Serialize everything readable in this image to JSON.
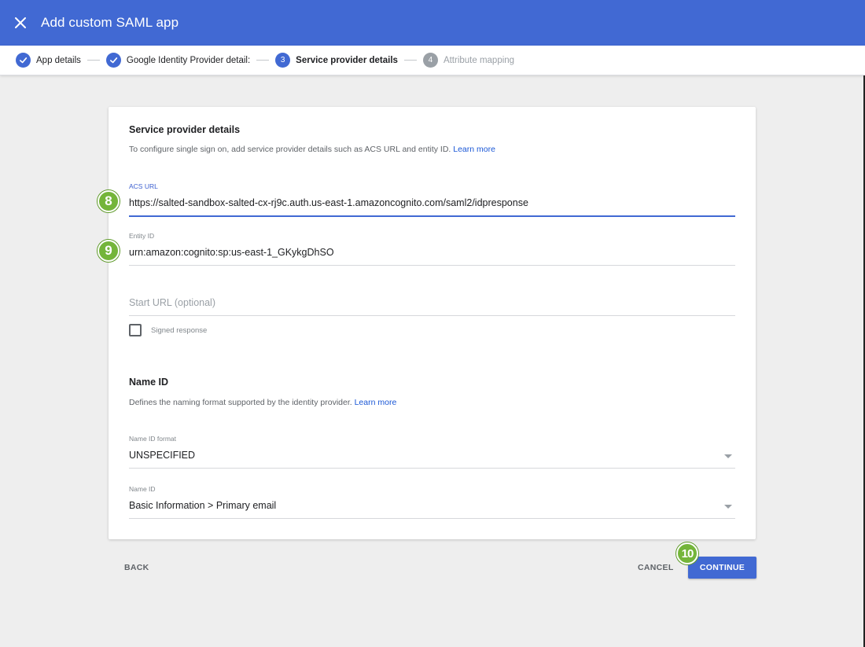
{
  "appbar": {
    "title": "Add custom SAML app"
  },
  "stepper": {
    "steps": [
      {
        "number": "",
        "label": "App details",
        "state": "done"
      },
      {
        "number": "",
        "label": "Google Identity Provider detail:",
        "state": "done"
      },
      {
        "number": "3",
        "label": "Service provider details",
        "state": "active"
      },
      {
        "number": "4",
        "label": "Attribute mapping",
        "state": "pending"
      }
    ]
  },
  "service_provider": {
    "title": "Service provider details",
    "description": "To configure single sign on, add service provider details such as ACS URL and entity ID.",
    "learn_more": "Learn more",
    "acs_url": {
      "label": "ACS URL",
      "value": "https://salted-sandbox-salted-cx-rj9c.auth.us-east-1.amazoncognito.com/saml2/idpresponse"
    },
    "entity_id": {
      "label": "Entity ID",
      "value": "urn:amazon:cognito:sp:us-east-1_GKykgDhSO"
    },
    "start_url": {
      "placeholder": "Start URL (optional)"
    },
    "signed_response": {
      "label": "Signed response",
      "checked": false
    }
  },
  "name_id": {
    "title": "Name ID",
    "description": "Defines the naming format supported by the identity provider.",
    "learn_more": "Learn more",
    "format": {
      "label": "Name ID format",
      "value": "UNSPECIFIED"
    },
    "name_id": {
      "label": "Name ID",
      "value": "Basic Information > Primary email"
    }
  },
  "actions": {
    "back": "BACK",
    "cancel": "CANCEL",
    "continue": "CONTINUE"
  },
  "badges": {
    "acs": "8",
    "entity": "9",
    "continue": "10"
  },
  "colors": {
    "primary": "#4169d3",
    "link": "#1a57d6",
    "badge": "#74b53a",
    "background": "#eeeeee"
  }
}
